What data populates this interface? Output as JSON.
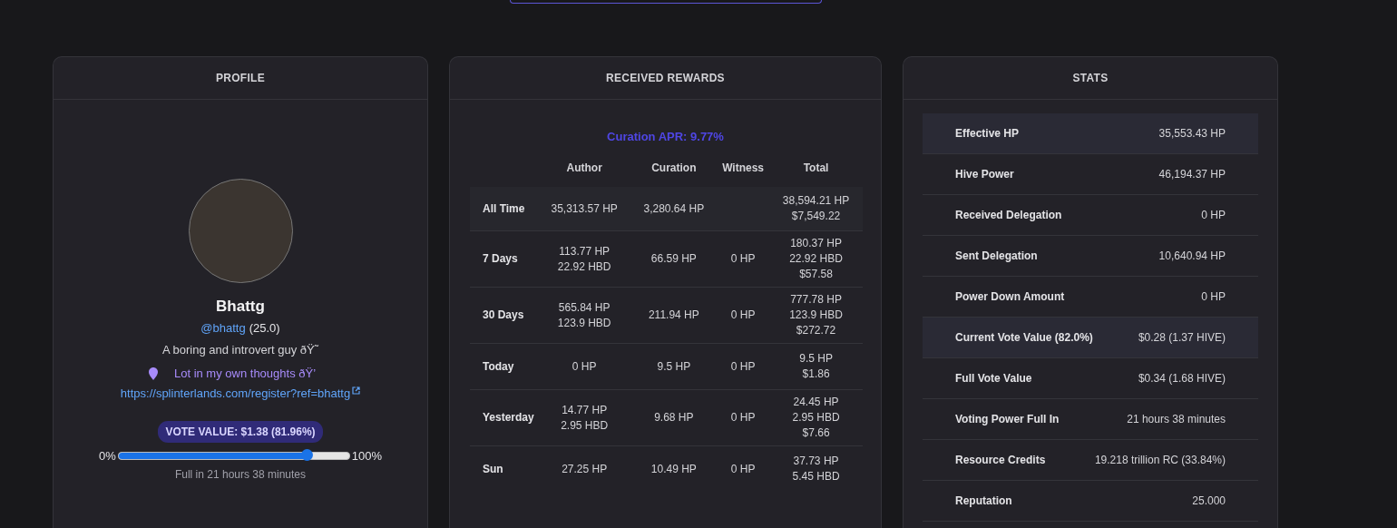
{
  "profile": {
    "title": "PROFILE",
    "name": "Bhattg",
    "handle": "@bhattg",
    "reputation": "(25.0)",
    "bio": "A boring and introvert guy ðŸ˜",
    "location": "Lot in my own thoughts ðŸ’",
    "website": "https://splinterlands.com/register?ref=bhattg",
    "vote_badge": "VOTE VALUE: $1.38 (81.96%)",
    "slider": {
      "min_label": "0%",
      "max_label": "100%",
      "level": 0.82
    },
    "full_in": "Full in 21 hours 38 minutes"
  },
  "rewards": {
    "title": "RECEIVED REWARDS",
    "curation_apr": "Curation APR: 9.77%",
    "columns": [
      "Author",
      "Curation",
      "Witness",
      "Total"
    ],
    "rows": [
      {
        "period": "All Time",
        "author": [
          "35,313.57 HP"
        ],
        "curation": [
          "3,280.64 HP"
        ],
        "total": [
          "38,594.21 HP",
          "$7,549.22"
        ]
      },
      {
        "period": "7 Days",
        "author": [
          "113.77 HP",
          "22.92 HBD"
        ],
        "curation": [
          "66.59 HP"
        ],
        "witness": [
          "0 HP"
        ],
        "total": [
          "180.37 HP",
          "22.92 HBD",
          "$57.58"
        ]
      },
      {
        "period": "30 Days",
        "author": [
          "565.84 HP",
          "123.9 HBD"
        ],
        "curation": [
          "211.94 HP"
        ],
        "witness": [
          "0 HP"
        ],
        "total": [
          "777.78 HP",
          "123.9 HBD",
          "$272.72"
        ]
      },
      {
        "period": "Today",
        "author": [
          "0 HP"
        ],
        "curation": [
          "9.5 HP"
        ],
        "witness": [
          "0 HP"
        ],
        "total": [
          "9.5 HP",
          "$1.86"
        ]
      },
      {
        "period": "Yesterday",
        "author": [
          "14.77 HP",
          "2.95 HBD"
        ],
        "curation": [
          "9.68 HP"
        ],
        "witness": [
          "0 HP"
        ],
        "total": [
          "24.45 HP",
          "2.95 HBD",
          "$7.66"
        ]
      },
      {
        "period": "Sun",
        "author": [
          "27.25 HP"
        ],
        "curation": [
          "10.49 HP"
        ],
        "witness": [
          "0 HP"
        ],
        "total": [
          "37.73 HP",
          "5.45 HBD"
        ]
      }
    ]
  },
  "stats": {
    "title": "STATS",
    "rows": [
      {
        "label": "Effective HP",
        "value": "35,553.43 HP",
        "highlighted": true
      },
      {
        "label": "Hive Power",
        "value": "46,194.37 HP",
        "highlighted": false
      },
      {
        "label": "Received Delegation",
        "value": "0 HP",
        "highlighted": false
      },
      {
        "label": "Sent Delegation",
        "value": "10,640.94 HP",
        "highlighted": false
      },
      {
        "label": "Power Down Amount",
        "value": "0 HP",
        "highlighted": false
      },
      {
        "label": "Current Vote Value (82.0%)",
        "value": "$0.28 (1.37 HIVE)",
        "highlighted": true
      },
      {
        "label": "Full Vote Value",
        "value": "$0.34 (1.68 HIVE)",
        "highlighted": false
      },
      {
        "label": "Voting Power Full In",
        "value": "21 hours 38 minutes",
        "highlighted": false
      },
      {
        "label": "Resource Credits",
        "value": "19.218 trillion RC (33.84%)",
        "highlighted": false
      },
      {
        "label": "Reputation",
        "value": "25.000",
        "highlighted": false
      }
    ]
  }
}
